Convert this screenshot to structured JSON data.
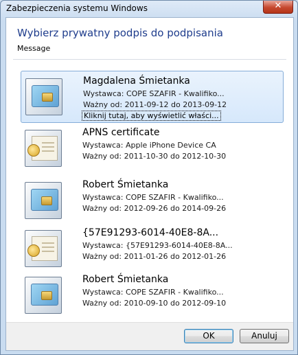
{
  "window": {
    "title": "Zabezpieczenia systemu Windows",
    "close_glyph": "✕"
  },
  "dialog": {
    "heading": "Wybierz prywatny podpis do podpisania",
    "message": "Message"
  },
  "certificates": [
    {
      "name": "Magdalena Śmietanka",
      "issuer": "Wystawca: COPE SZAFIR - Kwalifiko...",
      "valid": "Ważny od: 2011-09-12 do 2013-09-12",
      "link": "Kliknij tutaj, aby wyświetlić właści...",
      "icon": "smartcard-certificate-icon",
      "selected": true
    },
    {
      "name": "APNS certificate",
      "issuer": "Wystawca: Apple iPhone Device CA",
      "valid": "Ważny od: 2011-10-30 do 2012-10-30",
      "icon": "certificate-seal-icon"
    },
    {
      "name": "Robert Śmietanka",
      "issuer": "Wystawca: COPE SZAFIR - Kwalifiko...",
      "valid": "Ważny od: 2012-09-26 do 2014-09-26",
      "icon": "smartcard-certificate-icon"
    },
    {
      "name": "{57E91293-6014-40E8-8A...",
      "issuer": "Wystawca: {57E91293-6014-40E8-8A...",
      "valid": "Ważny od: 2011-01-26 do 2012-01-26",
      "icon": "certificate-seal-icon"
    },
    {
      "name": "Robert Śmietanka",
      "issuer": "Wystawca: COPE SZAFIR - Kwalifiko...",
      "valid": "Ważny od: 2010-09-10 do 2012-09-10",
      "icon": "smartcard-certificate-icon"
    }
  ],
  "buttons": {
    "ok": "OK",
    "cancel": "Anuluj"
  }
}
